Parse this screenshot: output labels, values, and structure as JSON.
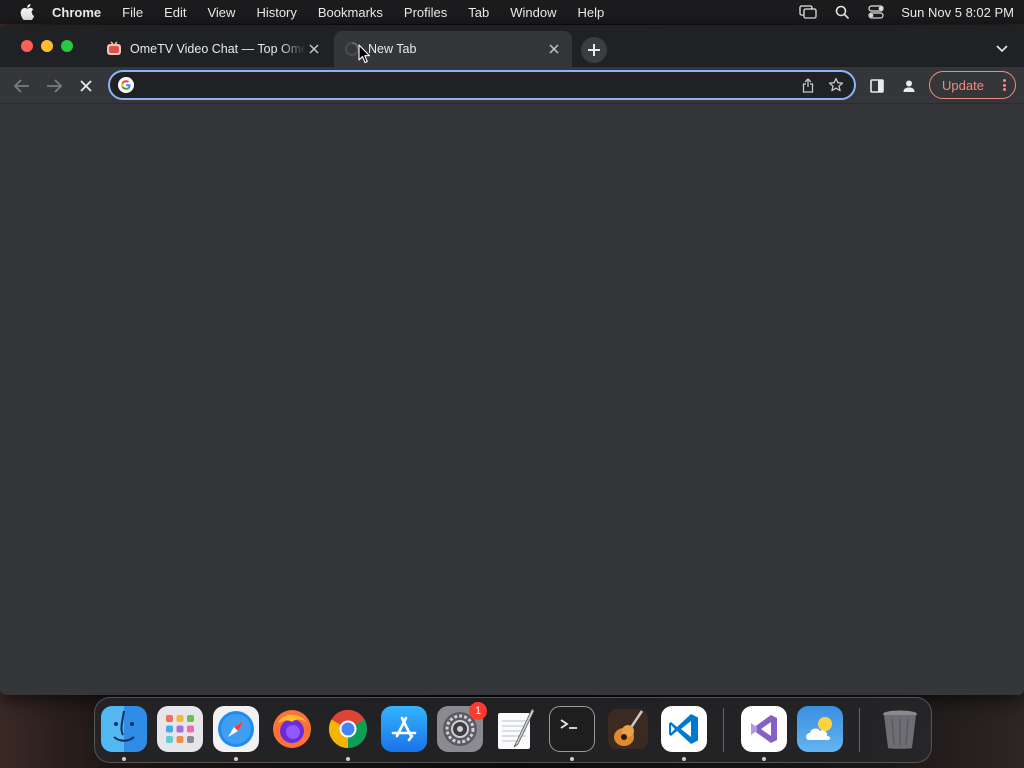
{
  "menubar": {
    "app_name": "Chrome",
    "items": [
      "File",
      "Edit",
      "View",
      "History",
      "Bookmarks",
      "Profiles",
      "Tab",
      "Window",
      "Help"
    ],
    "clock": "Sun Nov 5  8:02 PM",
    "status_icons": [
      "screen-mirroring-icon",
      "spotlight-search-icon",
      "control-center-icon"
    ]
  },
  "tabs": [
    {
      "title": "OmeTV Video Chat — Top Omegle",
      "favicon": "ometv-favicon",
      "active": false
    },
    {
      "title": "New Tab",
      "favicon": "loading",
      "active": true
    }
  ],
  "toolbar": {
    "omnibox_value": "",
    "update_label": "Update"
  },
  "dock": {
    "apps": [
      "Finder",
      "Launchpad",
      "Safari",
      "Firefox",
      "Google Chrome",
      "App Store",
      "System Settings",
      "TextEdit",
      "Terminal",
      "GarageBand",
      "Visual Studio Code",
      "Visual Studio",
      "Weather",
      "Trash"
    ],
    "system_settings_badge": "1"
  },
  "colors": {
    "accent_focus": "#8ab4f8",
    "update": "#f28b82",
    "tab_active": "#35363a",
    "tabstrip": "#202124"
  }
}
